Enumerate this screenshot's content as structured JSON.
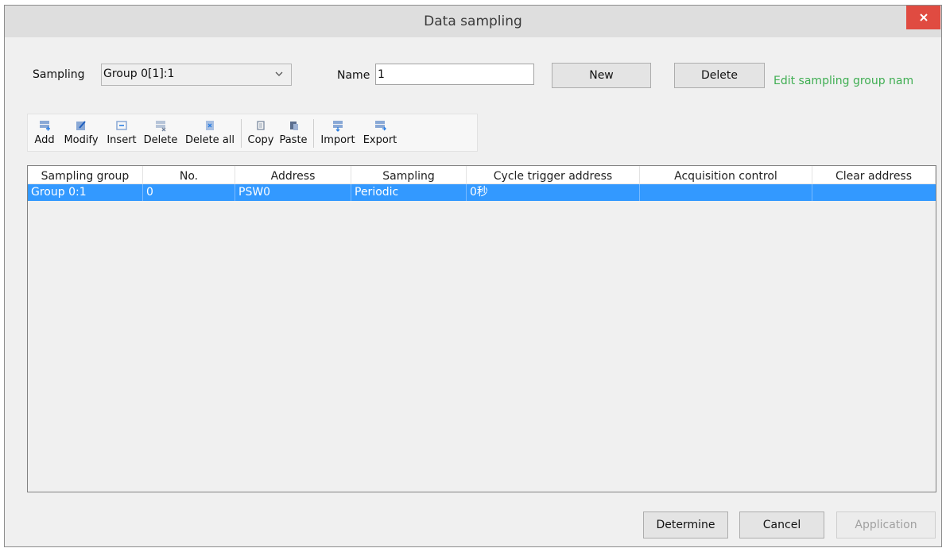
{
  "window": {
    "title": "Data sampling",
    "close_glyph": "×"
  },
  "form": {
    "sampling_label": "Sampling",
    "sampling_value": "Group 0[1]:1",
    "name_label": "Name",
    "name_value": "1",
    "new_label": "New",
    "delete_label": "Delete",
    "edit_link": "Edit sampling group nam"
  },
  "toolbar": {
    "items": [
      {
        "label": "Add",
        "icon": "add-icon"
      },
      {
        "label": "Modify",
        "icon": "modify-icon"
      },
      {
        "label": "Insert",
        "icon": "insert-icon"
      },
      {
        "label": "Delete",
        "icon": "delete-icon"
      },
      {
        "label": "Delete all",
        "icon": "delete-all-icon"
      },
      {
        "label": "Copy",
        "icon": "copy-icon"
      },
      {
        "label": "Paste",
        "icon": "paste-icon"
      },
      {
        "label": "Import",
        "icon": "import-icon"
      },
      {
        "label": "Export",
        "icon": "export-icon"
      }
    ]
  },
  "table": {
    "columns": [
      "Sampling group",
      "No.",
      "Address",
      "Sampling",
      "Cycle trigger address",
      "Acquisition control",
      "Clear address"
    ],
    "rows": [
      [
        "Group 0:1",
        "0",
        "PSW0",
        "Periodic",
        "0秒",
        "",
        ""
      ]
    ],
    "selected_color": "#3399ff"
  },
  "footer": {
    "determine_label": "Determine",
    "cancel_label": "Cancel",
    "application_label": "Application"
  },
  "colors": {
    "accent": "#3399ff",
    "close": "#e04b41",
    "link": "#3fae52"
  }
}
